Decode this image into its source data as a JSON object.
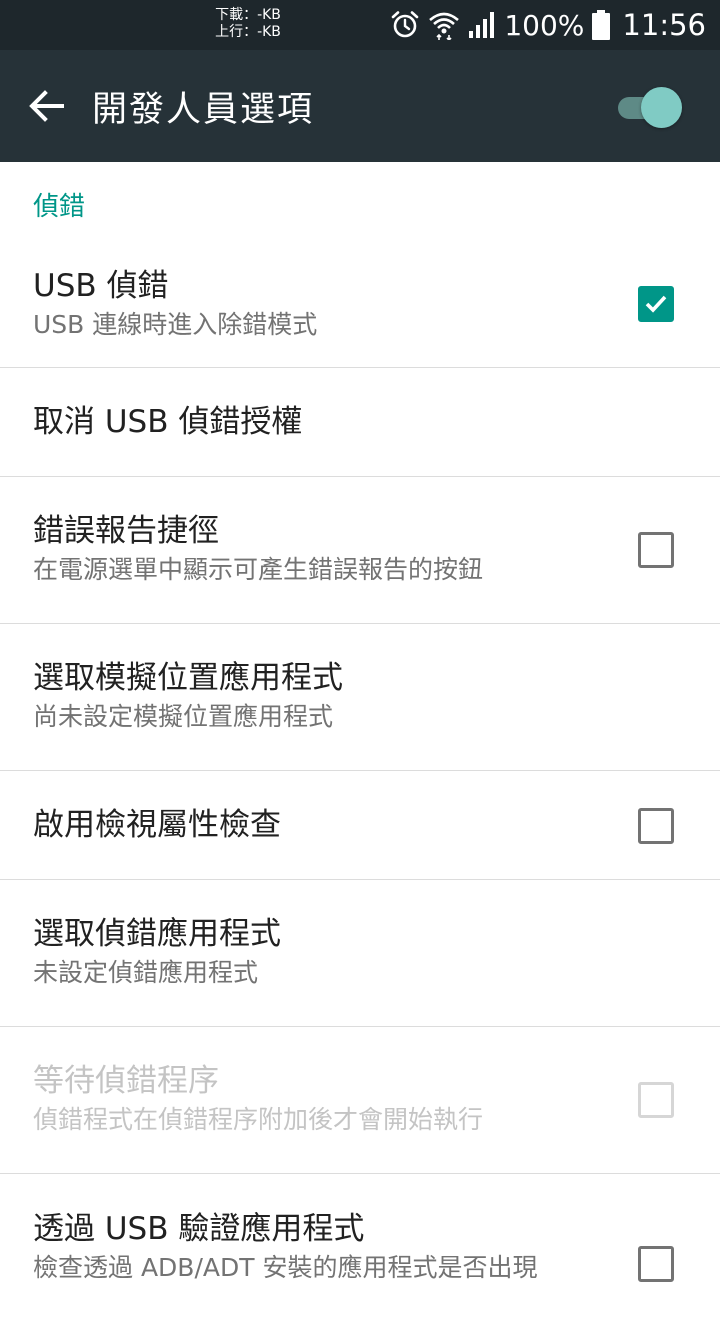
{
  "status_bar": {
    "download_speed": "下載：-KB",
    "upload_speed": "上行：-KB",
    "battery_percent": "100%",
    "time": "11:56",
    "icons": [
      "alarm-icon",
      "wifi-icon",
      "cell-signal-icon",
      "battery-icon"
    ]
  },
  "app_bar": {
    "back_icon": "back-arrow-icon",
    "title": "開發人員選項",
    "master_switch_on": true
  },
  "colors": {
    "app_bar": "#263238",
    "status_bar": "#1e272c",
    "accent": "#009688",
    "switch_thumb": "#80cbc4"
  },
  "section": {
    "header": "偵錯"
  },
  "items": [
    {
      "title": "USB 偵錯",
      "summary": "USB 連線時進入除錯模式",
      "checkbox": "checked"
    },
    {
      "title": "取消 USB 偵錯授權",
      "summary": "",
      "checkbox": "none"
    },
    {
      "title": "錯誤報告捷徑",
      "summary": "在電源選單中顯示可產生錯誤報告的按鈕",
      "checkbox": "unchecked"
    },
    {
      "title": "選取模擬位置應用程式",
      "summary": "尚未設定模擬位置應用程式",
      "checkbox": "none"
    },
    {
      "title": "啟用檢視屬性檢查",
      "summary": "",
      "checkbox": "unchecked"
    },
    {
      "title": "選取偵錯應用程式",
      "summary": "未設定偵錯應用程式",
      "checkbox": "none"
    },
    {
      "title": "等待偵錯程序",
      "summary": "偵錯程式在偵錯程序附加後才會開始執行",
      "checkbox": "disabled"
    },
    {
      "title": "透過 USB 驗證應用程式",
      "summary": "檢查透過 ADB/ADT 安裝的應用程式是否出現",
      "checkbox": "unchecked"
    }
  ]
}
